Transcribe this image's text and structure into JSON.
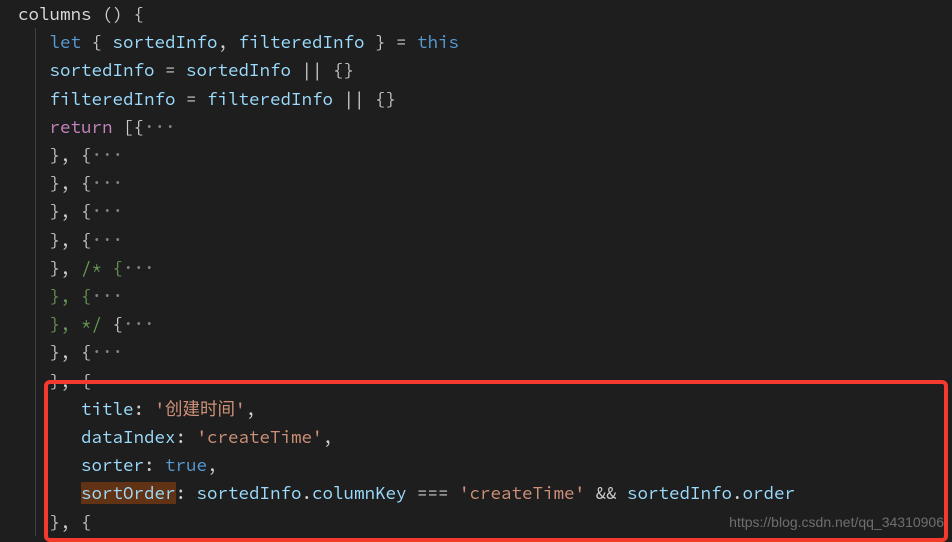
{
  "code": {
    "line1": {
      "a": "columns",
      "b": " ()",
      "c": " {"
    },
    "line2": {
      "a": "let",
      "b": " {",
      "c": " sortedInfo",
      "d": ",",
      "e": " filteredInfo",
      "f": " } = ",
      "g": "this"
    },
    "line3": {
      "a": "sortedInfo",
      "b": " = ",
      "c": "sortedInfo",
      "d": " || {}"
    },
    "line4": {
      "a": "filteredInfo",
      "b": " = ",
      "c": "filteredInfo",
      "d": " || {}"
    },
    "line5": {
      "a": "return",
      "b": " [{",
      "c": "···"
    },
    "fold": "···",
    "foldrow1": "}, {",
    "foldrow2": "}, /* {",
    "foldrow3": "}, */ {",
    "obj": {
      "title_label": "title",
      "title_value": "'创建时间'",
      "dataIndex_label": "dataIndex",
      "dataIndex_value": "'createTime'",
      "sorter_label": "sorter",
      "sorter_value": "true",
      "sortOrder_label": "sortOrder",
      "sortOrder_expr_pre": ": sortedInfo.columnKey === ",
      "sortOrder_expr_str": "'createTime'",
      "sortOrder_expr_post": " && sortedInfo.order"
    }
  },
  "watermark": "https://blog.csdn.net/qq_34310906"
}
